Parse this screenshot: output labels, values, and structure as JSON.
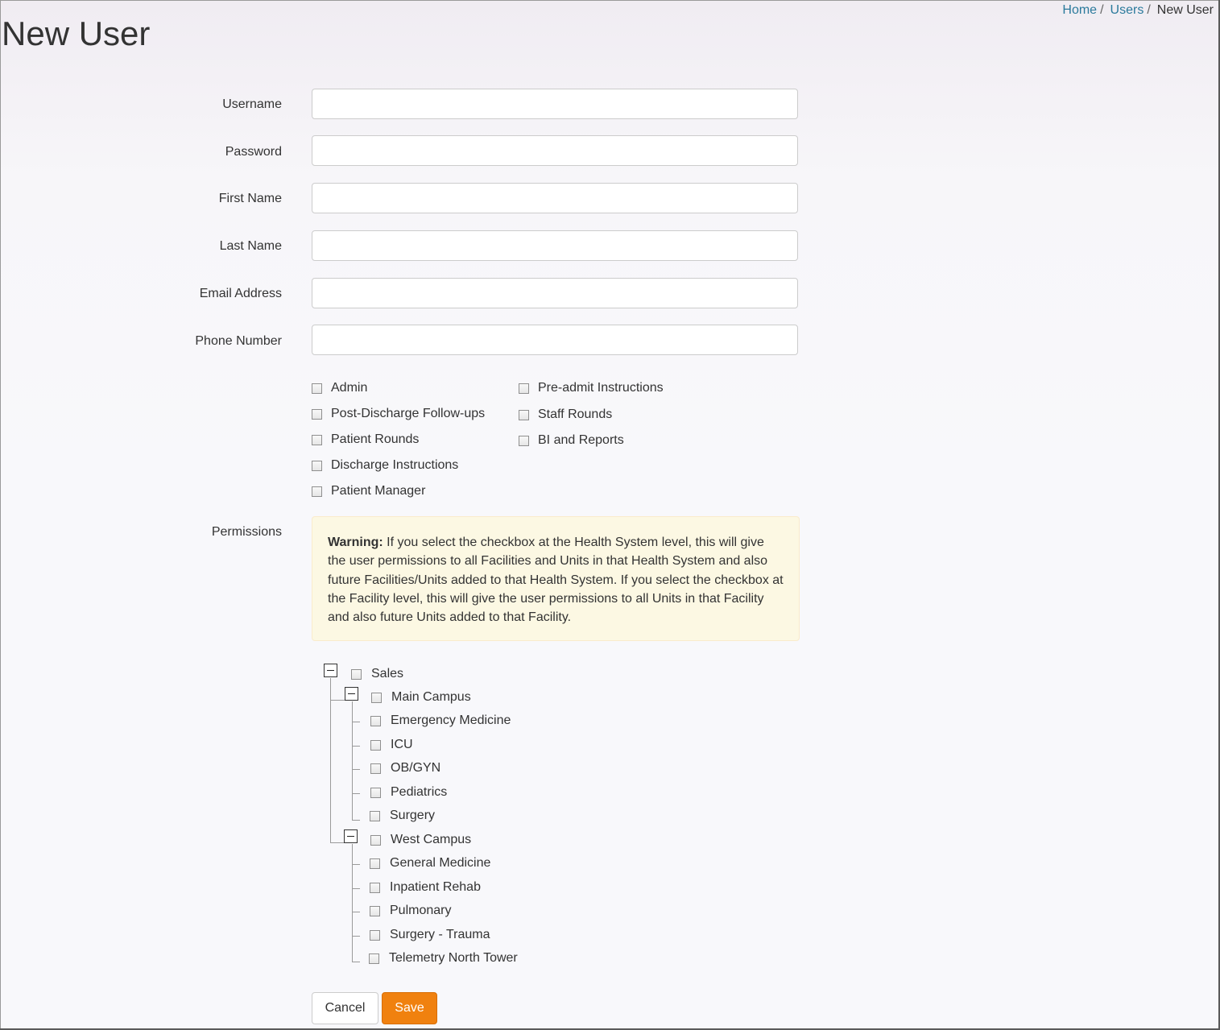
{
  "breadcrumb": {
    "home": "Home",
    "users": "Users",
    "current": "New User",
    "separator": "/"
  },
  "page": {
    "title": "New User"
  },
  "form": {
    "fields": [
      {
        "label": "Username",
        "value": ""
      },
      {
        "label": "Password",
        "value": ""
      },
      {
        "label": "First Name",
        "value": ""
      },
      {
        "label": "Last Name",
        "value": ""
      },
      {
        "label": "Email Address",
        "value": ""
      },
      {
        "label": "Phone Number",
        "value": ""
      }
    ],
    "roles_left": [
      "Admin",
      "Post-Discharge Follow-ups",
      "Patient Rounds",
      "Discharge Instructions",
      "Patient Manager"
    ],
    "roles_right": [
      "Pre-admit Instructions",
      "Staff Rounds",
      "BI and Reports"
    ],
    "permissions_label": "Permissions",
    "warning": {
      "title": "Warning:",
      "text": " If you select the checkbox at the Health System level, this will give the user permissions to all Facilities and Units in that Health System and also future Facilities/Units added to that Health System. If you select the checkbox at the Facility level, this will give the user permissions to all Units in that Facility and also future Units added to that Facility."
    },
    "tree": {
      "root": "Sales",
      "facilities": [
        {
          "name": "Main Campus",
          "units": [
            "Emergency Medicine",
            "ICU",
            "OB/GYN",
            "Pediatrics",
            "Surgery"
          ]
        },
        {
          "name": "West Campus",
          "units": [
            "General Medicine",
            "Inpatient Rehab",
            "Pulmonary",
            "Surgery - Trauma",
            "Telemetry North Tower"
          ]
        }
      ]
    }
  },
  "buttons": {
    "cancel": "Cancel",
    "save": "Save"
  },
  "colors": {
    "accent": "#f0810f",
    "link": "#2b7a9c",
    "warning_bg": "#fcf8e3"
  }
}
